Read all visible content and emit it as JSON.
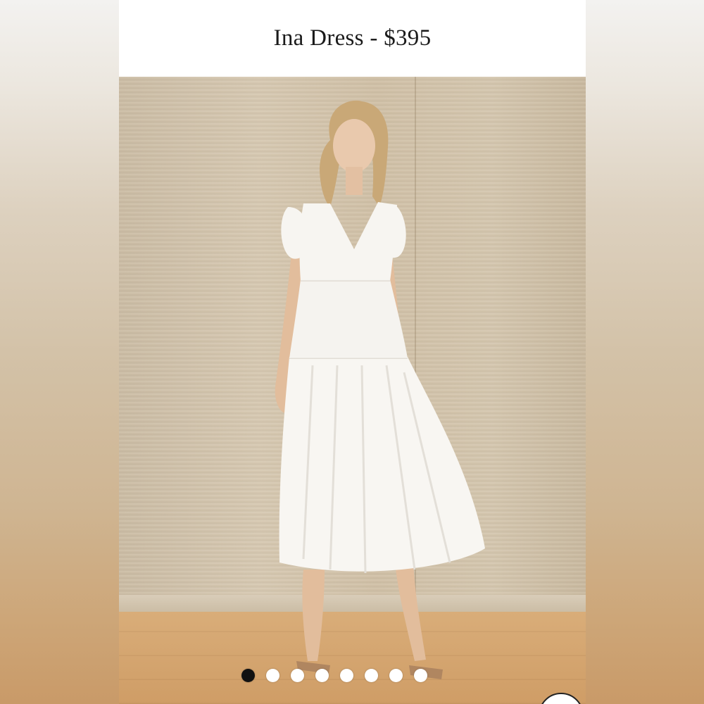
{
  "product": {
    "title": "Ina Dress - $395"
  },
  "carousel": {
    "total_slides": 8,
    "active_index": 0
  },
  "colors": {
    "dot_active": "#111111",
    "dot_inactive": "#ffffff",
    "dress": "#f7f5f1"
  }
}
